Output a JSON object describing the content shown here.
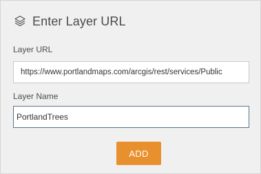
{
  "header": {
    "icon": "layers-icon",
    "title": "Enter Layer URL"
  },
  "layer_url": {
    "label": "Layer URL",
    "value": "https://www.portlandmaps.com/arcgis/rest/services/Public"
  },
  "layer_name": {
    "label": "Layer Name",
    "value": "PortlandTrees"
  },
  "add_button": {
    "label": "ADD",
    "color": "#e8902e"
  }
}
